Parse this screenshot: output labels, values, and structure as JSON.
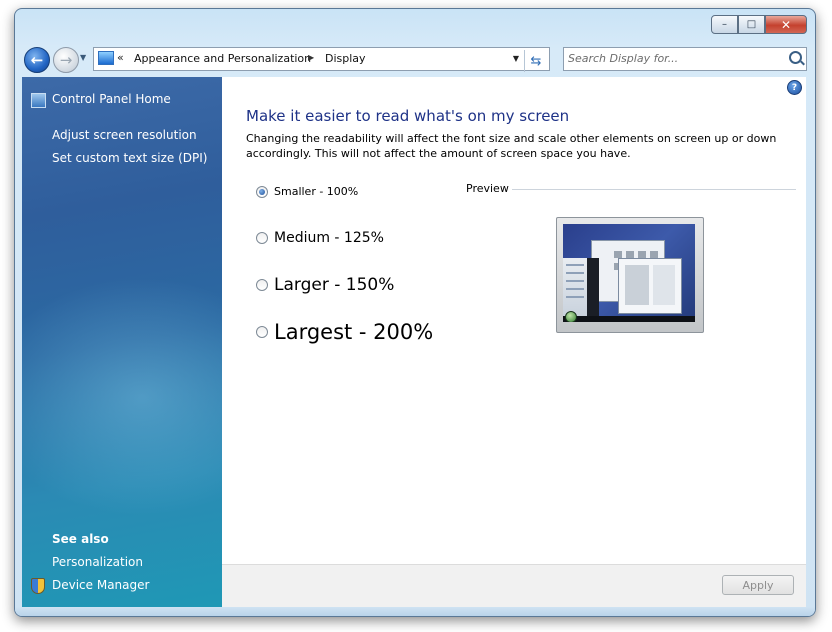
{
  "window": {
    "caption_buttons": {
      "minimize": "–",
      "maximize": "□",
      "close": "✕"
    }
  },
  "nav": {
    "back": "←",
    "forward": "→",
    "history_drop": "▼",
    "address_chevron": "«",
    "breadcrumb": [
      "Appearance and Personalization",
      "Display"
    ],
    "crumb_separator": "▶",
    "address_drop": "▼",
    "refresh": "⇆",
    "search_placeholder": "Search Display for..."
  },
  "sidebar": {
    "home": "Control Panel Home",
    "tasks": [
      "Adjust screen resolution",
      "Set custom text size (DPI)"
    ],
    "see_also_title": "See also",
    "see_also": [
      "Personalization",
      "Device Manager"
    ]
  },
  "main": {
    "help": "?",
    "title": "Make it easier to read what's on my screen",
    "description": "Changing the readability will affect the font size and scale other elements on screen up or down accordingly. This will not affect the amount of screen space you have.",
    "options": [
      {
        "label": "Smaller - 100%",
        "checked": true
      },
      {
        "label": "Medium - 125%",
        "checked": false
      },
      {
        "label": "Larger - 150%",
        "checked": false
      },
      {
        "label": "Largest - 200%",
        "checked": false
      }
    ],
    "preview_label": "Preview"
  },
  "footer": {
    "apply_label": "Apply"
  }
}
